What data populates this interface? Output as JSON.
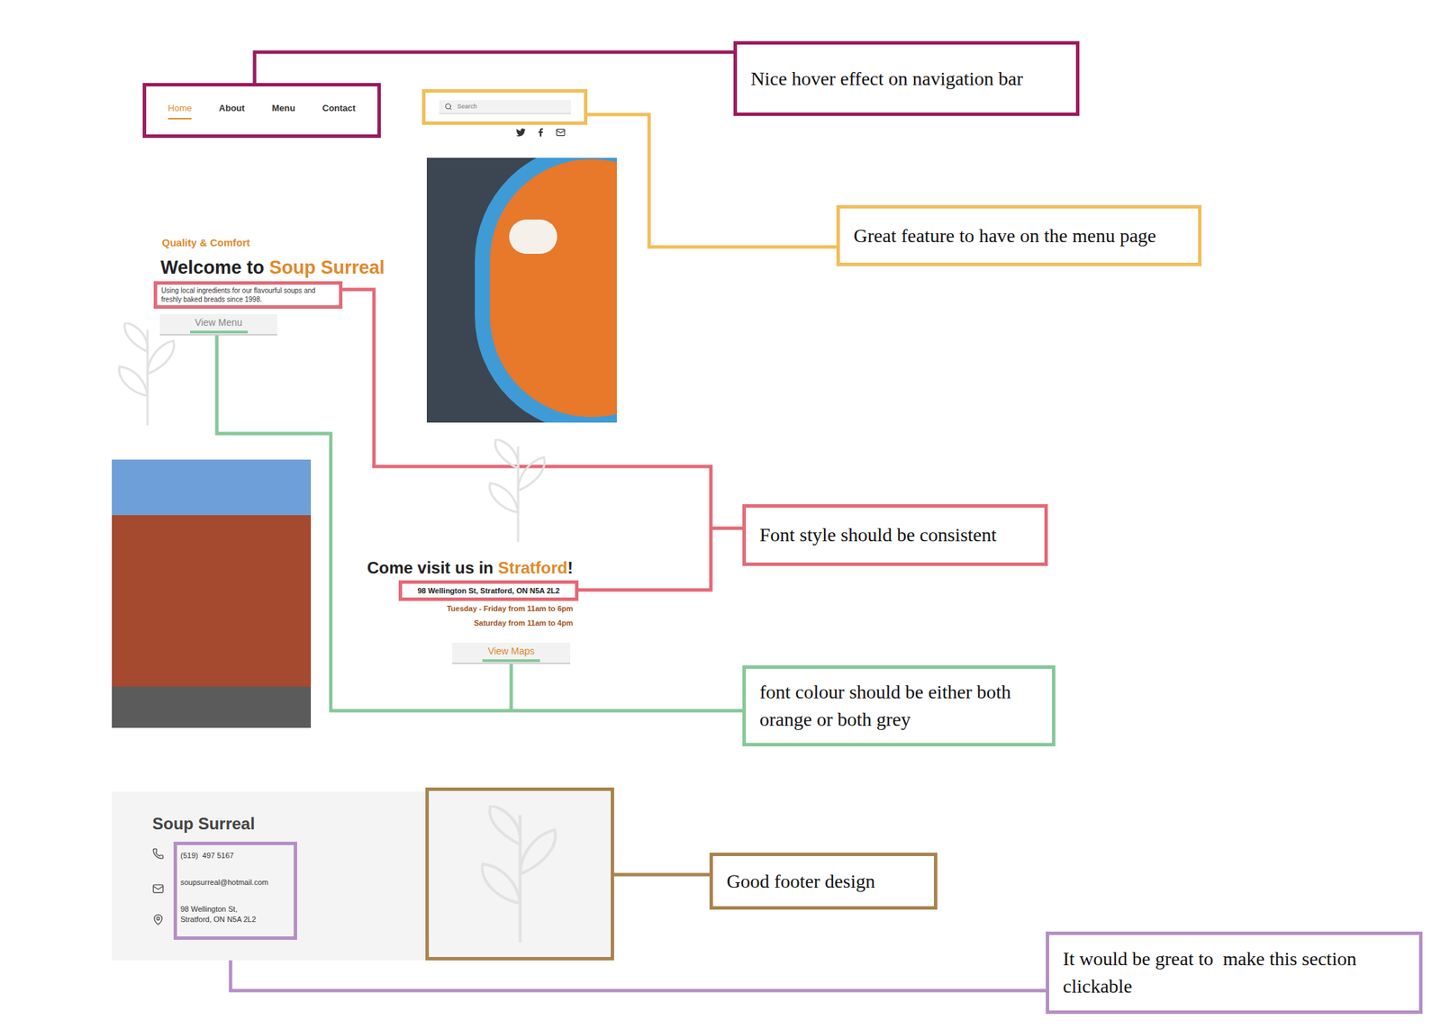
{
  "website": {
    "nav": [
      {
        "label": "Home",
        "selected": true
      },
      {
        "label": "About",
        "selected": false
      },
      {
        "label": "Menu",
        "selected": false
      },
      {
        "label": "Contact",
        "selected": false
      }
    ],
    "search": {
      "placeholder": "Search"
    },
    "hero": {
      "eyebrow": "Quality & Comfort",
      "title": "Welcome to ",
      "title_highlight": "Soup Surreal",
      "description": "Using local ingredients for our flavourful soups and freshly baked breads since 1998.",
      "button": "View Menu"
    },
    "visit": {
      "title": "Come visit us in ",
      "title_highlight": "Stratford",
      "title_end": "!",
      "address": "98 Wellington St, Stratford, ON N5A 2L2",
      "hours": [
        "Tuesday - Friday from 11am to 6pm",
        "Saturday from 11am to 4pm"
      ],
      "button": "View Maps"
    },
    "footer": {
      "brand": "Soup Surreal",
      "contacts": [
        {
          "kind": "phone",
          "lines": [
            "(519)  497 5167"
          ]
        },
        {
          "kind": "email",
          "lines": [
            "soupsurreal@hotmail.com"
          ]
        },
        {
          "kind": "address",
          "lines": [
            "98 Wellington St,",
            "Stratford, ON N5A 2L2"
          ]
        }
      ]
    }
  },
  "annotations": [
    {
      "text": "Nice hover effect on navigation bar",
      "color": "#9b1a5c"
    },
    {
      "text": "Great feature to have on the menu page",
      "color": "#f0bf5a"
    },
    {
      "text": "Font style should be consistent",
      "color": "#e46a78"
    },
    {
      "text": "font colour should be either both orange or both grey",
      "color": "#86c89a"
    },
    {
      "text": "Good footer design",
      "color": "#a8844f"
    },
    {
      "text": "It would be great to  make this section clickable",
      "color": "#b58fc4"
    }
  ]
}
